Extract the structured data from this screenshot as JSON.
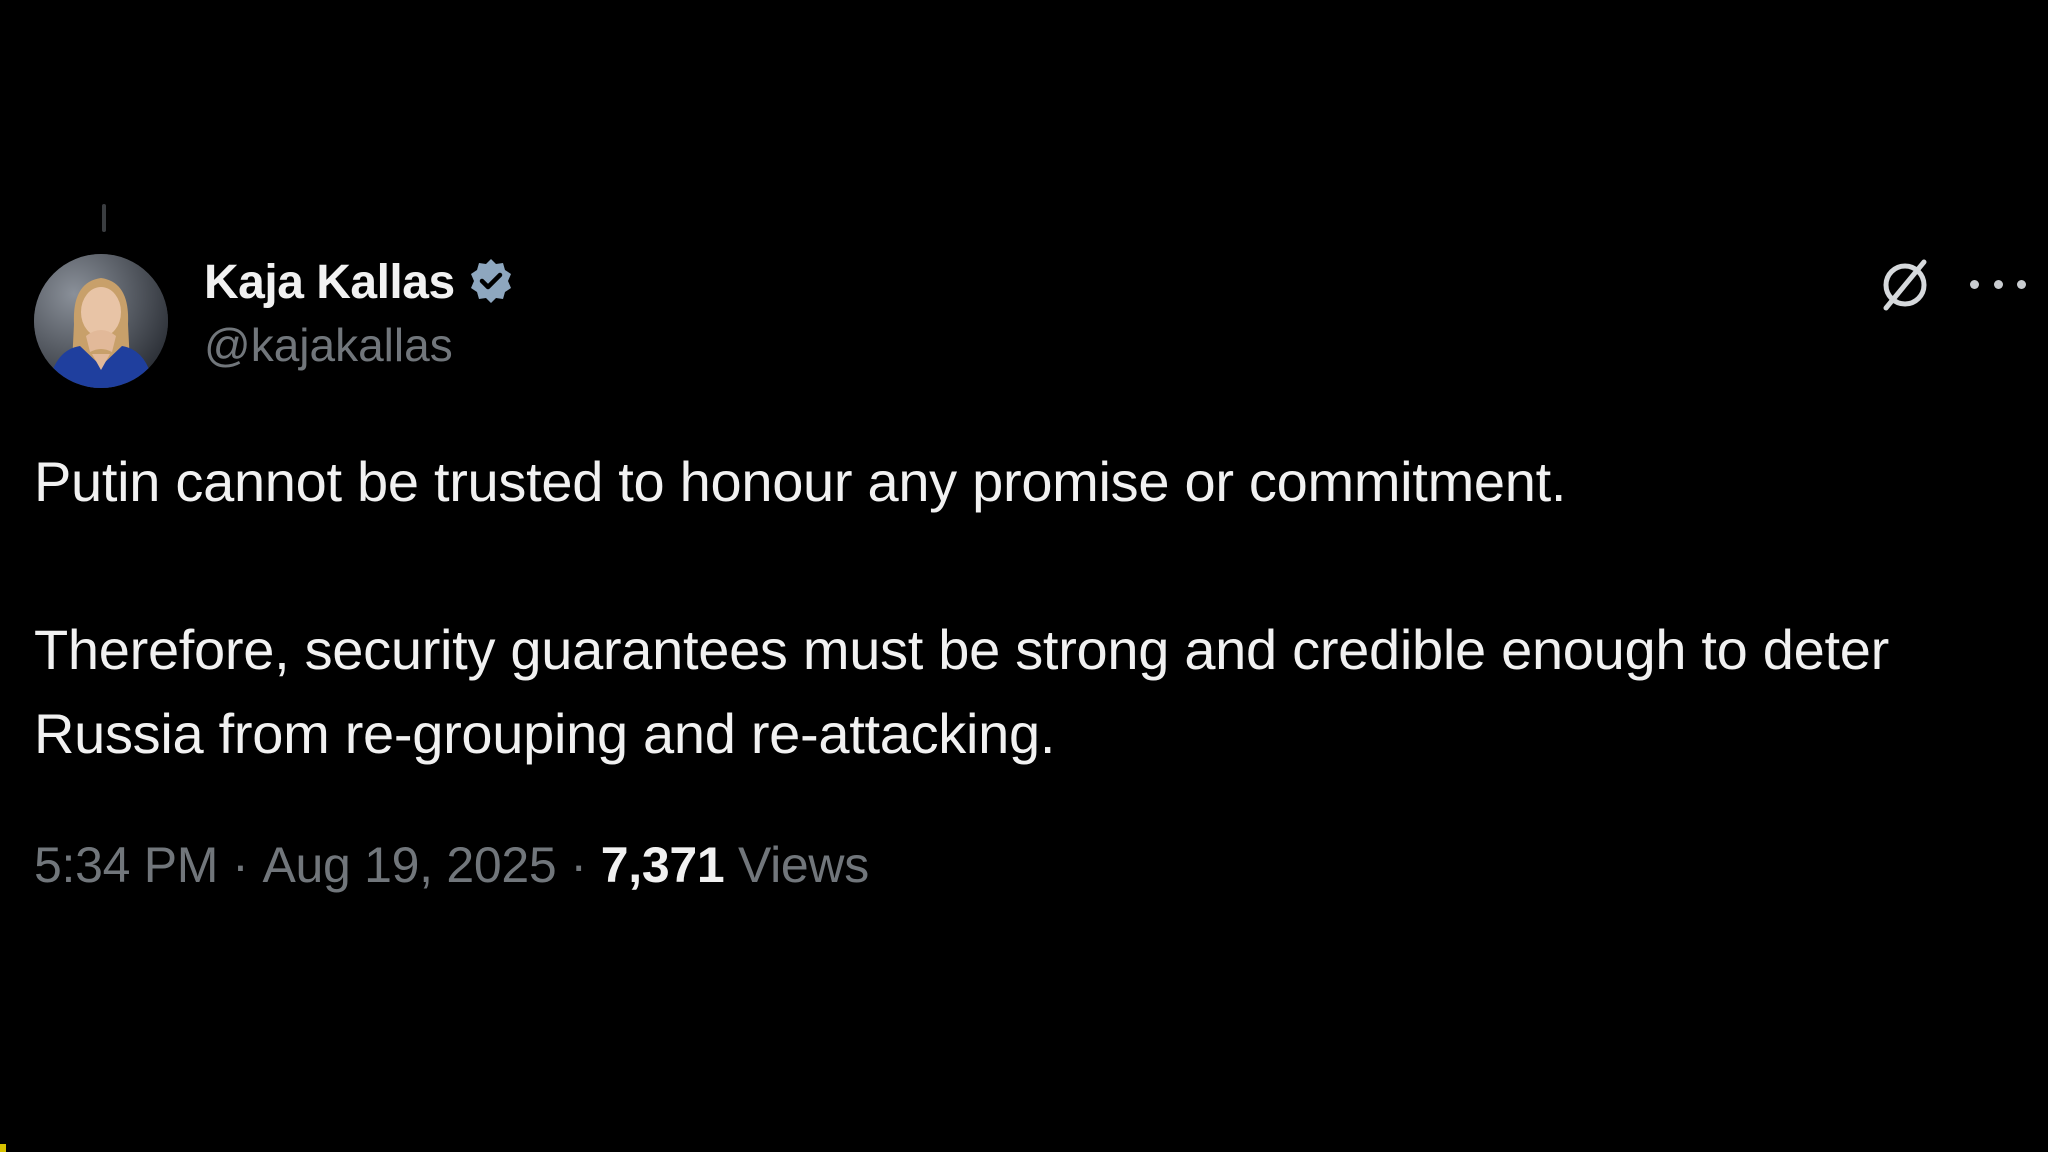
{
  "tweet": {
    "author": {
      "display_name": "Kaja Kallas",
      "handle": "@kajakallas",
      "verified": true,
      "avatar_icon": "profile-photo"
    },
    "paragraphs": [
      "Putin cannot be trusted to honour any promise or commitment.",
      "Therefore, security guarantees must be strong and credible enough to deter Russia from re-grouping and re-attacking."
    ],
    "time": "5:34 PM",
    "date": "Aug 19, 2025",
    "separator": "·",
    "views_count": "7,371",
    "views_label": "Views"
  },
  "icons": {
    "verified": "verified-badge-icon",
    "grok": "grok-icon",
    "more": "more-options-icon"
  },
  "colors": {
    "background": "#000000",
    "text_primary": "#f1f1f1",
    "text_secondary": "#71767b",
    "verified_badge": "#8ea7bf"
  }
}
